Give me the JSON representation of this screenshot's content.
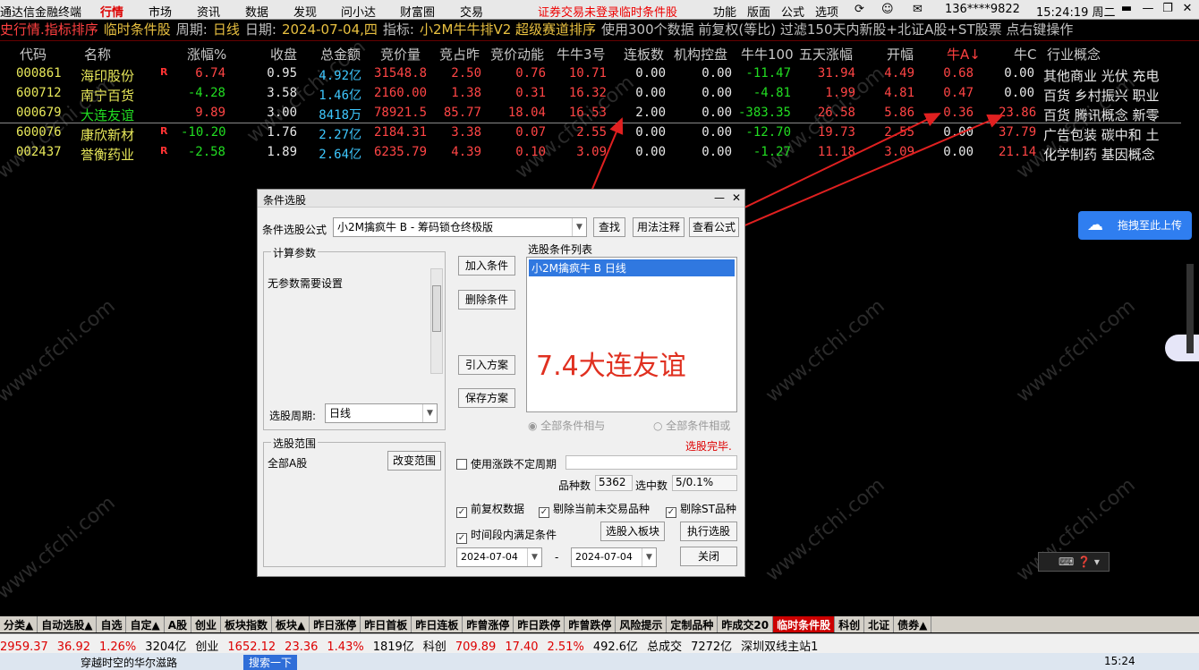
{
  "menu": {
    "app_title": "通达信金融终端",
    "items": [
      "行情",
      "市场",
      "资讯",
      "数据",
      "发现",
      "问小达",
      "财富圈",
      "交易"
    ],
    "active": "行情",
    "warnings": [
      "证券交易未登录",
      "临时条件股"
    ],
    "right_items": [
      "功能",
      "版面",
      "公式",
      "选项"
    ],
    "account": "136****9822",
    "clock": "15:24:19 周二"
  },
  "infobar": {
    "segments": [
      {
        "text": "史行情.指标排序",
        "color": "#ff4040"
      },
      {
        "text": "临时条件股",
        "color": "#e8c040"
      },
      {
        "text": "周期:",
        "color": "#c0c0c0"
      },
      {
        "text": "日线",
        "color": "#e8c040"
      },
      {
        "text": "日期:",
        "color": "#c0c0c0"
      },
      {
        "text": "2024-07-04,四",
        "color": "#e8c040"
      },
      {
        "text": "指标:",
        "color": "#c0c0c0"
      },
      {
        "text": "小2M牛牛排V2 超级赛道排序",
        "color": "#e8c040"
      },
      {
        "text": "使用300个数据 前复权(等比) 过滤150天内新股+北证A股+ST股票 点右键操作",
        "color": "#c0c0c0"
      }
    ]
  },
  "table": {
    "headers": [
      "代码",
      "名称",
      "涨幅%",
      "收盘",
      "总金额",
      "竞价量",
      "竞占昨",
      "竞价动能",
      "牛牛3号",
      "连板数",
      "机构控盘",
      "牛牛100",
      "五天涨幅",
      "开幅",
      "牛A↓",
      "牛C",
      "行业概念"
    ],
    "rows": [
      {
        "code": "000861",
        "name": "海印股份",
        "r": "R",
        "chg": "6.74",
        "close": "0.95",
        "amt": "4.92亿",
        "bidvol": "31548.8",
        "bidpct": "2.50",
        "bidmom": "0.76",
        "nn3": "10.71",
        "lb": "0.00",
        "jg": "0.00",
        "nn100": "-11.47",
        "d5": "31.94",
        "kf": "4.49",
        "na": "0.68",
        "nc": "0.00",
        "concept": "其他商业  光伏 充电"
      },
      {
        "code": "600712",
        "name": "南宁百货",
        "r": "",
        "chg": "-4.28",
        "close": "3.58",
        "amt": "1.46亿",
        "bidvol": "2160.00",
        "bidpct": "1.38",
        "bidmom": "0.31",
        "nn3": "16.32",
        "lb": "0.00",
        "jg": "0.00",
        "nn100": "-4.81",
        "d5": "1.99",
        "kf": "4.81",
        "na": "0.47",
        "nc": "0.00",
        "concept": "百货  乡村振兴 职业"
      },
      {
        "code": "000679",
        "name": "大连友谊",
        "r": "",
        "chg": "9.89",
        "close": "3.00",
        "amt": "8418万",
        "bidvol": "78921.5",
        "bidpct": "85.77",
        "bidmom": "18.04",
        "nn3": "16.53",
        "lb": "2.00",
        "jg": "0.00",
        "nn100": "-383.35",
        "d5": "26.58",
        "kf": "5.86",
        "na": "0.36",
        "nc": "23.86",
        "concept": "百货  腾讯概念 新零"
      },
      {
        "code": "600076",
        "name": "康欣新材",
        "r": "R",
        "chg": "-10.20",
        "close": "1.76",
        "amt": "2.27亿",
        "bidvol": "2184.31",
        "bidpct": "3.38",
        "bidmom": "0.07",
        "nn3": "2.55",
        "lb": "0.00",
        "jg": "0.00",
        "nn100": "-12.70",
        "d5": "19.73",
        "kf": "2.55",
        "na": "0.00",
        "nc": "37.79",
        "concept": "广告包装  碳中和 土"
      },
      {
        "code": "002437",
        "name": "誉衡药业",
        "r": "R",
        "chg": "-2.58",
        "close": "1.89",
        "amt": "2.64亿",
        "bidvol": "6235.79",
        "bidpct": "4.39",
        "bidmom": "0.10",
        "nn3": "3.09",
        "lb": "0.00",
        "jg": "0.00",
        "nn100": "-1.27",
        "d5": "11.18",
        "kf": "3.09",
        "na": "0.00",
        "nc": "21.14",
        "concept": "化学制药  基因概念"
      }
    ]
  },
  "dialog": {
    "title": "条件选股",
    "formula_label": "条件选股公式",
    "formula_value": "小2M擒疯牛 B  -  筹码锁仓终极版",
    "find_button": "查找",
    "usage_button": "用法注释",
    "view_formula_button": "查看公式",
    "calc_params_label": "计算参数",
    "no_params_text": "无参数需要设置",
    "period_label": "选股周期:",
    "period_value": "日线",
    "add_condition": "加入条件",
    "delete_condition": "删除条件",
    "import_plan": "引入方案",
    "save_plan": "保存方案",
    "cond_list_label": "选股条件列表",
    "cond_list_items": [
      "小2M擒疯牛 B  日线"
    ],
    "annotation": "7.4大连友谊",
    "radio_and": "全部条件相与",
    "radio_or": "全部条件相或",
    "done_text": "选股完毕.",
    "range_label": "选股范围",
    "range_value": "全部A股",
    "change_range": "改变范围",
    "use_period_check": "使用涨跌不定周期",
    "count_label": "品种数",
    "count_value": "5362",
    "selected_label": "选中数",
    "selected_value": "5/0.1%",
    "chk_fq": "前复权数据",
    "chk_exclude_untraded": "剔除当前未交易品种",
    "chk_exclude_st": "剔除ST品种",
    "chk_period": "时间段内满足条件",
    "to_block_button": "选股入板块",
    "execute_button": "执行选股",
    "date_from": "2024-07-04",
    "date_sep": "-",
    "date_to": "2024-07-04",
    "close_button": "关闭"
  },
  "upload_button": "拖拽至此上传",
  "tabs": [
    "分类▲",
    "自动选股▲",
    "自选",
    "自定▲",
    "A股",
    "创业",
    "板块指数",
    "板块▲",
    "昨日涨停",
    "昨日首板",
    "昨日连板",
    "昨曾涨停",
    "昨日跌停",
    "昨曾跌停",
    "风险提示",
    "定制品种",
    "昨成交20",
    "临时条件股",
    "科创",
    "北证",
    "债券▲"
  ],
  "active_tab": "临时条件股",
  "status": [
    {
      "text": "2959.37",
      "color": "#d00"
    },
    {
      "text": "36.92",
      "color": "#d00"
    },
    {
      "text": "1.26%",
      "color": "#d00"
    },
    {
      "text": "3204亿",
      "color": "#000"
    },
    {
      "text": "创业",
      "color": "#000"
    },
    {
      "text": "1652.12",
      "color": "#d00"
    },
    {
      "text": "23.36",
      "color": "#d00"
    },
    {
      "text": "1.43%",
      "color": "#d00"
    },
    {
      "text": "1819亿",
      "color": "#000"
    },
    {
      "text": "科创",
      "color": "#000"
    },
    {
      "text": "709.89",
      "color": "#d00"
    },
    {
      "text": "17.40",
      "color": "#d00"
    },
    {
      "text": "2.51%",
      "color": "#d00"
    },
    {
      "text": "492.6亿",
      "color": "#000"
    },
    {
      "text": "总成交",
      "color": "#000"
    },
    {
      "text": "7272亿",
      "color": "#000"
    },
    {
      "text": "深圳双线主站1",
      "color": "#000"
    }
  ],
  "taskbar": {
    "search_text": "穿越时空的华尔滋路",
    "search_btn": "搜索一下",
    "time": "15:24"
  },
  "watermark": "www.cfchi.com"
}
